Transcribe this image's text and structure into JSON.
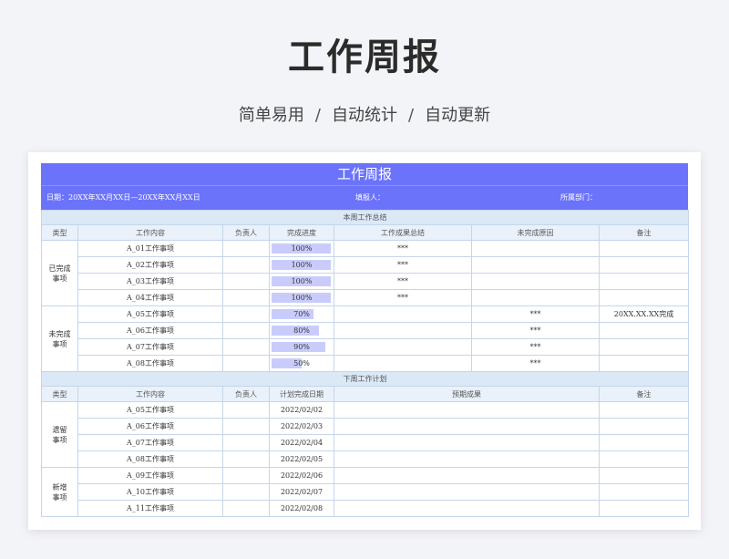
{
  "hero": {
    "title": "工作周报",
    "subtitle_parts": [
      "简单易用",
      "/",
      "自动统计",
      "/",
      "自动更新"
    ]
  },
  "sheet": {
    "title": "工作周报",
    "date_label": "日期：20XX年XX月XX日—20XX年XX月XX日",
    "filler_label": "填报人：",
    "dept_label": "所属部门：",
    "accent_color": "#6b73fb",
    "progress_color": "#c9ccfb",
    "summary": {
      "section_title": "本周工作总结",
      "headers": [
        "类型",
        "工作内容",
        "负责人",
        "完成进度",
        "工作成果总结",
        "未完成原因",
        "备注"
      ],
      "groups": [
        {
          "type": "已完成\n事项",
          "rows": [
            {
              "content": "A_01工作事项",
              "owner": "",
              "progress": 1.0,
              "progress_text": "100%",
              "result": "***",
              "reason": "",
              "note": ""
            },
            {
              "content": "A_02工作事项",
              "owner": "",
              "progress": 1.0,
              "progress_text": "100%",
              "result": "***",
              "reason": "",
              "note": ""
            },
            {
              "content": "A_03工作事项",
              "owner": "",
              "progress": 1.0,
              "progress_text": "100%",
              "result": "***",
              "reason": "",
              "note": ""
            },
            {
              "content": "A_04工作事项",
              "owner": "",
              "progress": 1.0,
              "progress_text": "100%",
              "result": "***",
              "reason": "",
              "note": ""
            }
          ]
        },
        {
          "type": "未完成\n事项",
          "rows": [
            {
              "content": "A_05工作事项",
              "owner": "",
              "progress": 0.7,
              "progress_text": "70%",
              "result": "",
              "reason": "***",
              "note": "20XX.XX.XX完成"
            },
            {
              "content": "A_06工作事项",
              "owner": "",
              "progress": 0.8,
              "progress_text": "80%",
              "result": "",
              "reason": "***",
              "note": ""
            },
            {
              "content": "A_07工作事项",
              "owner": "",
              "progress": 0.9,
              "progress_text": "90%",
              "result": "",
              "reason": "***",
              "note": ""
            },
            {
              "content": "A_08工作事项",
              "owner": "",
              "progress": 0.5,
              "progress_text": "50%",
              "result": "",
              "reason": "***",
              "note": ""
            }
          ]
        }
      ]
    },
    "plan": {
      "section_title": "下周工作计划",
      "headers": [
        "类型",
        "工作内容",
        "负责人",
        "计划完成日期",
        "预期成果",
        "备注"
      ],
      "groups": [
        {
          "type": "遗留\n事项",
          "rows": [
            {
              "content": "A_05工作事项",
              "owner": "",
              "date": "2022/02/02",
              "expected": "",
              "note": ""
            },
            {
              "content": "A_06工作事项",
              "owner": "",
              "date": "2022/02/03",
              "expected": "",
              "note": ""
            },
            {
              "content": "A_07工作事项",
              "owner": "",
              "date": "2022/02/04",
              "expected": "",
              "note": ""
            },
            {
              "content": "A_08工作事项",
              "owner": "",
              "date": "2022/02/05",
              "expected": "",
              "note": ""
            }
          ]
        },
        {
          "type": "新增\n事项",
          "rows": [
            {
              "content": "A_09工作事项",
              "owner": "",
              "date": "2022/02/06",
              "expected": "",
              "note": ""
            },
            {
              "content": "A_10工作事项",
              "owner": "",
              "date": "2022/02/07",
              "expected": "",
              "note": ""
            },
            {
              "content": "A_11工作事项",
              "owner": "",
              "date": "2022/02/08",
              "expected": "",
              "note": ""
            }
          ]
        }
      ]
    }
  }
}
